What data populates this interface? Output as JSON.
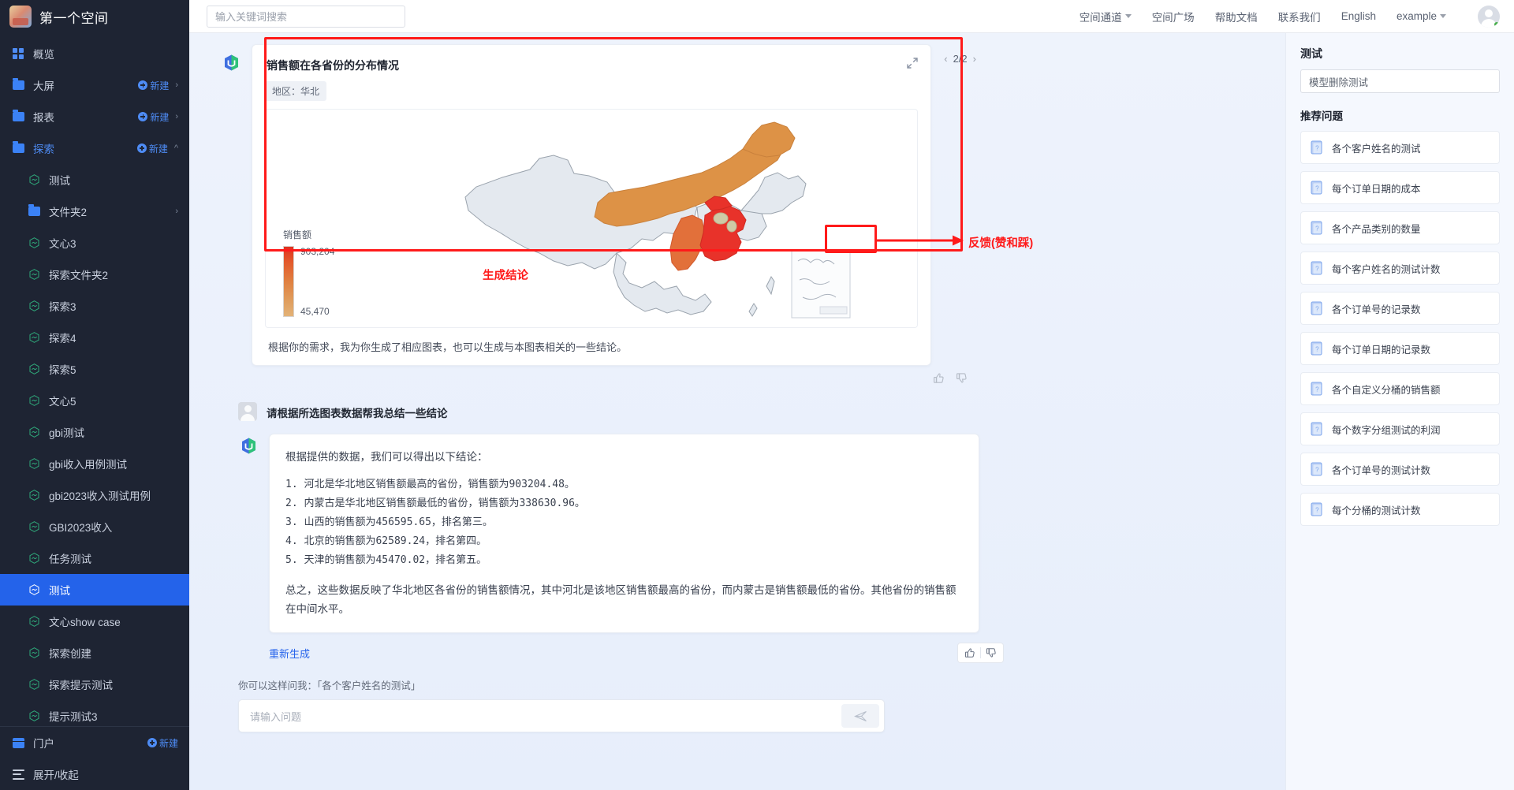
{
  "sidebar": {
    "brand": "第一个空间",
    "new_label": "新建",
    "top_items": [
      {
        "label": "概览",
        "icon": "grid-icon",
        "has_new": false,
        "has_chevron": false
      },
      {
        "label": "大屏",
        "icon": "folder-icon",
        "has_new": true,
        "has_chevron": true
      },
      {
        "label": "报表",
        "icon": "folder-icon",
        "has_new": true,
        "has_chevron": true
      },
      {
        "label": "探索",
        "icon": "folder-icon",
        "has_new": true,
        "has_chevron": true,
        "highlighted": true
      }
    ],
    "explore_children": [
      {
        "label": "测试",
        "icon": "chart-hex-icon"
      },
      {
        "label": "文件夹2",
        "icon": "folder-icon",
        "has_chevron": true
      },
      {
        "label": "文心3",
        "icon": "chart-hex-icon"
      },
      {
        "label": "探索文件夹2",
        "icon": "chart-hex-icon"
      },
      {
        "label": "探索3",
        "icon": "chart-hex-icon"
      },
      {
        "label": "探索4",
        "icon": "chart-hex-icon"
      },
      {
        "label": "探索5",
        "icon": "chart-hex-icon"
      },
      {
        "label": "文心5",
        "icon": "chart-hex-icon"
      },
      {
        "label": "gbi测试",
        "icon": "chart-hex-icon"
      },
      {
        "label": "gbi收入用例测试",
        "icon": "chart-hex-icon"
      },
      {
        "label": "gbi2023收入测试用例",
        "icon": "chart-hex-icon"
      },
      {
        "label": "GBI2023收入",
        "icon": "chart-hex-icon"
      },
      {
        "label": "任务测试",
        "icon": "chart-hex-icon"
      },
      {
        "label": "测试",
        "icon": "chart-hex-icon",
        "active": true
      },
      {
        "label": "文心show case",
        "icon": "chart-hex-icon"
      },
      {
        "label": "探索创建",
        "icon": "chart-hex-icon"
      },
      {
        "label": "探索提示测试",
        "icon": "chart-hex-icon"
      },
      {
        "label": "提示测试3",
        "icon": "chart-hex-icon"
      }
    ],
    "portal": {
      "label": "门户",
      "new_label": "新建"
    },
    "collapse": {
      "label": "展开/收起"
    }
  },
  "topbar": {
    "search_placeholder": "输入关键词搜索",
    "nav": [
      {
        "label": "空间通道",
        "has_caret": true
      },
      {
        "label": "空间广场",
        "has_caret": false
      },
      {
        "label": "帮助文档",
        "has_caret": false
      },
      {
        "label": "联系我们",
        "has_caret": false
      },
      {
        "label": "English",
        "has_caret": false
      },
      {
        "label": "example",
        "has_caret": true
      }
    ]
  },
  "chart_card": {
    "title": "销售额在各省份的分布情况",
    "chip": "地区：华北",
    "pager": {
      "current": "2/2",
      "prev": "‹",
      "next": "›"
    },
    "note": "根据你的需求，我为你生成了相应图表，也可以生成与本图表相关的一些结论。"
  },
  "chart_data": {
    "type": "map",
    "title": "销售额在各省份的分布情况",
    "region_filter": "地区：华北",
    "metric": "销售额",
    "legend_max": "903,204",
    "legend_min": "45,470",
    "colorscale_low": "#e0a060",
    "colorscale_high": "#e03020",
    "categories": [
      "河北",
      "内蒙古",
      "山西",
      "北京",
      "天津"
    ],
    "values": [
      903204.48,
      338630.96,
      456595.65,
      62589.24,
      45470.02
    ],
    "base_region_color": "#e4e9ef"
  },
  "conversation": {
    "user_question": "请根据所选图表数据帮我总结一些结论",
    "answer_lead": "根据提供的数据，我们可以得出以下结论：",
    "answer_list": [
      "1. 河北是华北地区销售额最高的省份，销售额为903204.48。",
      "2. 内蒙古是华北地区销售额最低的省份，销售额为338630.96。",
      "3. 山西的销售额为456595.65，排名第三。",
      "4. 北京的销售额为62589.24，排名第四。",
      "5. 天津的销售额为45470.02，排名第五。"
    ],
    "answer_summary": "总之，这些数据反映了华北地区各省份的销售额情况，其中河北是该地区销售额最高的省份，而内蒙古是销售额最低的省份。其他省份的销售额在中间水平。",
    "regenerate": "重新生成"
  },
  "composer": {
    "hint": "你可以这样问我：「各个客户姓名的测试」",
    "placeholder": "请输入问题"
  },
  "annotations": [
    {
      "text": "反馈(赞和踩)",
      "color": "#ff1a1a"
    },
    {
      "text": "生成结论",
      "color": "#ff1a1a"
    }
  ],
  "right_panel": {
    "title": "测试",
    "selected_model": "模型删除测试",
    "section_title": "推荐问题",
    "questions": [
      "各个客户姓名的测试",
      "每个订单日期的成本",
      "各个产品类别的数量",
      "每个客户姓名的测试计数",
      "各个订单号的记录数",
      "每个订单日期的记录数",
      "各个自定义分桶的销售额",
      "每个数字分组测试的利润",
      "各个订单号的测试计数",
      "每个分桶的测试计数"
    ]
  },
  "colors": {
    "accent": "#2463ea",
    "sidebar_bg": "#1e2433",
    "annotation_red": "#ff1a1a",
    "link_blue": "#2563eb"
  }
}
